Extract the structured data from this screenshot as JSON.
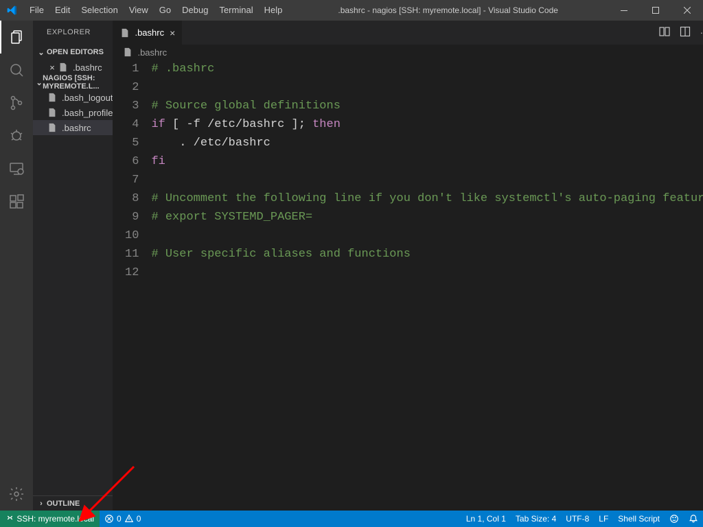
{
  "menu": [
    "File",
    "Edit",
    "Selection",
    "View",
    "Go",
    "Debug",
    "Terminal",
    "Help"
  ],
  "title": ".bashrc - nagios [SSH: myremote.local] - Visual Studio Code",
  "explorer": {
    "title": "EXPLORER",
    "open_editors_hdr": "OPEN EDITORS",
    "open_editors": [
      ".bashrc"
    ],
    "workspace_hdr": "NAGIOS [SSH: MYREMOTE.L...",
    "files": [
      ".bash_logout",
      ".bash_profile",
      ".bashrc"
    ],
    "active_file": ".bashrc",
    "outline_hdr": "OUTLINE"
  },
  "tab": {
    "label": ".bashrc"
  },
  "breadcrumb": ".bashrc",
  "code": {
    "lines": [
      [
        {
          "t": "# .bashrc",
          "c": "comment"
        }
      ],
      [
        {
          "t": "",
          "c": "default"
        }
      ],
      [
        {
          "t": "# Source global definitions",
          "c": "comment"
        }
      ],
      [
        {
          "t": "if",
          "c": "keyword"
        },
        {
          "t": " [ -f /etc/bashrc ]; ",
          "c": "default"
        },
        {
          "t": "then",
          "c": "keyword"
        }
      ],
      [
        {
          "t": "    . /etc/bashrc",
          "c": "default"
        }
      ],
      [
        {
          "t": "fi",
          "c": "keyword"
        }
      ],
      [
        {
          "t": "",
          "c": "default"
        }
      ],
      [
        {
          "t": "# Uncomment the following line if you don't like systemctl's auto-paging feature:",
          "c": "comment"
        }
      ],
      [
        {
          "t": "# export SYSTEMD_PAGER=",
          "c": "comment"
        }
      ],
      [
        {
          "t": "",
          "c": "default"
        }
      ],
      [
        {
          "t": "# User specific aliases and functions",
          "c": "comment"
        }
      ],
      [
        {
          "t": "",
          "c": "default"
        }
      ]
    ]
  },
  "status": {
    "remote": "SSH: myremote.local",
    "errors": "0",
    "warnings": "0",
    "ln_col": "Ln 1, Col 1",
    "tabsize": "Tab Size: 4",
    "encoding": "UTF-8",
    "eol": "LF",
    "lang": "Shell Script"
  }
}
